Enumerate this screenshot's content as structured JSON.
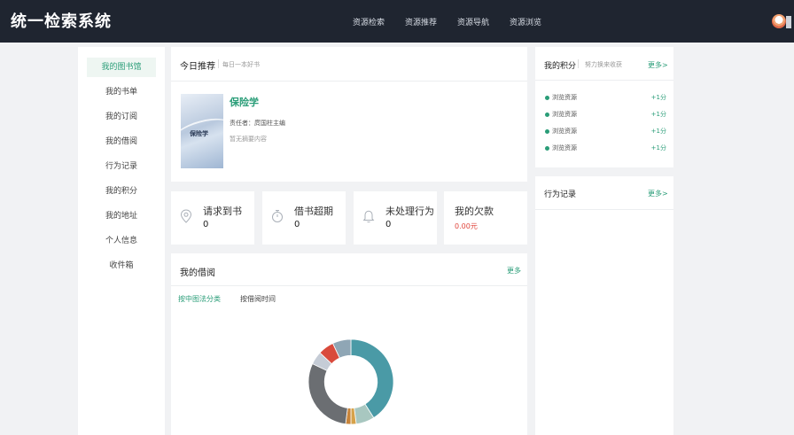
{
  "header": {
    "brand": "统一检索系统",
    "nav": [
      "资源检索",
      "资源推荐",
      "资源导航",
      "资源浏览"
    ]
  },
  "sidebar": {
    "items": [
      "我的图书馆",
      "我的书单",
      "我的订阅",
      "我的借阅",
      "行为记录",
      "我的积分",
      "我的地址",
      "个人信息",
      "收件箱"
    ]
  },
  "recommend": {
    "title": "今日推荐",
    "subtitle": "每日一本好书",
    "cover_text": "保险学",
    "book_title": "保险学",
    "editor": "责任者：庹国柱主编",
    "summary": "暂无摘要内容"
  },
  "stats": [
    {
      "label": "请求到书",
      "value": "0",
      "icon": "location-pin-icon"
    },
    {
      "label": "借书超期",
      "value": "0",
      "icon": "stopwatch-icon"
    },
    {
      "label": "未处理行为",
      "value": "0",
      "icon": "bell-icon"
    },
    {
      "label": "我的欠款",
      "value": "0.00元",
      "icon": ""
    }
  ],
  "borrow": {
    "title": "我的借阅",
    "more": "更多",
    "tabs": [
      "按中图法分类",
      "按借阅时间"
    ],
    "active_tab": "按中图法分类"
  },
  "points": {
    "title": "我的积分",
    "subtitle": "努力换来收获",
    "more": "更多>",
    "rows": [
      {
        "label": "浏览资源",
        "value": "+1分"
      },
      {
        "label": "浏览资源",
        "value": "+1分"
      },
      {
        "label": "浏览资源",
        "value": "+1分"
      },
      {
        "label": "浏览资源",
        "value": "+1分"
      }
    ]
  },
  "behavior": {
    "title": "行为记录",
    "more": "更多>"
  },
  "colors": {
    "accent": "#2a9d78",
    "topbar": "#1f2530",
    "debt": "#e0463c"
  },
  "chart_data": {
    "type": "pie",
    "hole": 0.62,
    "slices": [
      {
        "value": 41,
        "color": "#4a9aa6"
      },
      {
        "value": 7,
        "color": "#a8c7c0"
      },
      {
        "value": 2,
        "color": "#d6a24a"
      },
      {
        "value": 2,
        "color": "#c8843a"
      },
      {
        "value": 30,
        "color": "#6b6e72"
      },
      {
        "value": 5,
        "color": "#c5ccd6"
      },
      {
        "value": 6,
        "color": "#d94a3c"
      },
      {
        "value": 7,
        "color": "#8fa6b5"
      }
    ]
  }
}
